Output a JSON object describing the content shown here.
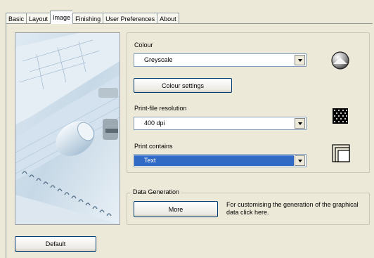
{
  "tabs": [
    {
      "label": "Basic",
      "active": false
    },
    {
      "label": "Layout",
      "active": false
    },
    {
      "label": "Image",
      "active": true
    },
    {
      "label": "Finishing",
      "active": false
    },
    {
      "label": "User Preferences",
      "active": false
    },
    {
      "label": "About",
      "active": false
    }
  ],
  "colour": {
    "label": "Colour",
    "value": "Greyscale",
    "icon": "greyscale-circle-icon"
  },
  "colour_settings_button": "Colour settings",
  "resolution": {
    "label": "Print-file resolution",
    "value": "400 dpi",
    "icon": "dot-grid-icon"
  },
  "print_contains": {
    "label": "Print contains",
    "value": "Text",
    "icon": "overlapping-pages-icon"
  },
  "data_generation": {
    "legend": "Data Generation",
    "button": "More",
    "description": "For customising the generation of the graphical data click here."
  },
  "default_button": "Default",
  "colors": {
    "accent": "#316ac5",
    "button_border": "#003c74",
    "background": "#ece9d8"
  }
}
